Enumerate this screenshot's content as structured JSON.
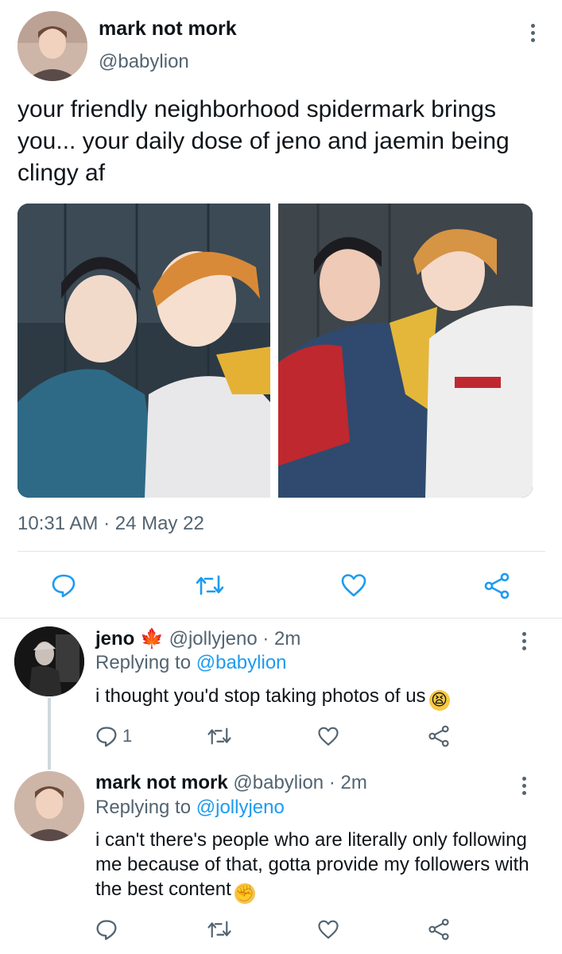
{
  "tweet": {
    "author_name": "mark not mork",
    "author_handle": "@babylion",
    "text": "your friendly neighborhood spidermark brings you... your daily dose of jeno and jaemin being clingy af",
    "timestamp": "10:31 AM · 24 May 22",
    "media_alt_left": "photo",
    "media_alt_right": "photo"
  },
  "replies": [
    {
      "name": "jeno",
      "badge": "🍁",
      "handle": "@jollyjeno",
      "time": "· 2m",
      "replying_prefix": "Replying to",
      "replying_to": "@babylion",
      "text": "i thought you'd stop taking photos of us",
      "emoji": "😫",
      "reply_count": "1"
    },
    {
      "name": "mark not mork",
      "handle": "@babylion",
      "time": "· 2m",
      "replying_prefix": "Replying to",
      "replying_to": "@jollyjeno",
      "text": "i can't there's people who are literally only following me because of that, gotta provide my followers with the best content",
      "emoji": "✊"
    }
  ],
  "colors": {
    "text": "#0f1419",
    "secondary": "#536471",
    "link": "#1d9bf0",
    "divider": "#e1e6ea"
  },
  "icons": [
    "reply-icon",
    "retweet-icon",
    "like-icon",
    "share-icon",
    "more-icon"
  ]
}
